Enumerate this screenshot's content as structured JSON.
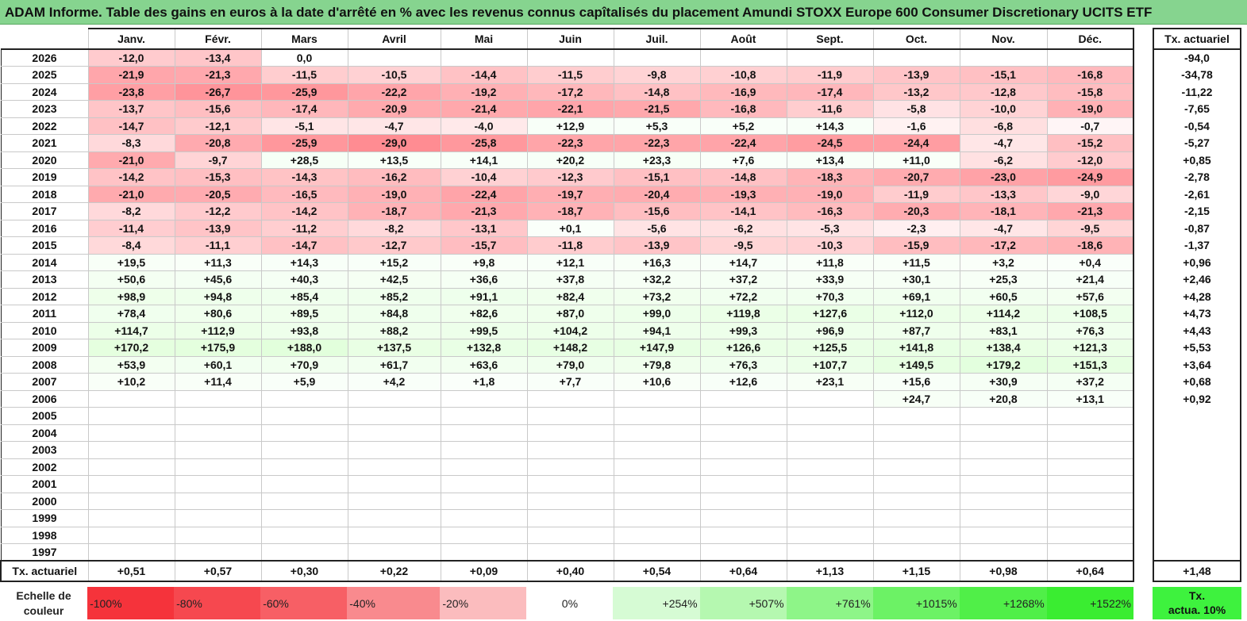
{
  "title": "ADAM Informe. Table des gains en euros à la date d'arrêté en % avec les revenus connus capîtalisés du placement Amundi STOXX Europe 600 Consumer Discretionary UCITS ETF",
  "months": [
    "Janv.",
    "Févr.",
    "Mars",
    "Avril",
    "Mai",
    "Juin",
    "Juil.",
    "Août",
    "Sept.",
    "Oct.",
    "Nov.",
    "Déc."
  ],
  "annual_header": "Tx. actuariel",
  "rows": [
    {
      "year": "2026",
      "values": [
        "-12,0",
        "-13,4",
        "0,0",
        "",
        "",
        "",
        "",
        "",
        "",
        "",
        "",
        ""
      ],
      "rate": "-94,0"
    },
    {
      "year": "2025",
      "values": [
        "-21,9",
        "-21,3",
        "-11,5",
        "-10,5",
        "-14,4",
        "-11,5",
        "-9,8",
        "-10,8",
        "-11,9",
        "-13,9",
        "-15,1",
        "-16,8"
      ],
      "rate": "-34,78"
    },
    {
      "year": "2024",
      "values": [
        "-23,8",
        "-26,7",
        "-25,9",
        "-22,2",
        "-19,2",
        "-17,2",
        "-14,8",
        "-16,9",
        "-17,4",
        "-13,2",
        "-12,8",
        "-15,8"
      ],
      "rate": "-11,22"
    },
    {
      "year": "2023",
      "values": [
        "-13,7",
        "-15,6",
        "-17,4",
        "-20,9",
        "-21,4",
        "-22,1",
        "-21,5",
        "-16,8",
        "-11,6",
        "-5,8",
        "-10,0",
        "-19,0"
      ],
      "rate": "-7,65"
    },
    {
      "year": "2022",
      "values": [
        "-14,7",
        "-12,1",
        "-5,1",
        "-4,7",
        "-4,0",
        "+12,9",
        "+5,3",
        "+5,2",
        "+14,3",
        "-1,6",
        "-6,8",
        "-0,7"
      ],
      "rate": "-0,54"
    },
    {
      "year": "2021",
      "values": [
        "-8,3",
        "-20,8",
        "-25,9",
        "-29,0",
        "-25,8",
        "-22,3",
        "-22,3",
        "-22,4",
        "-24,5",
        "-24,4",
        "-4,7",
        "-15,2"
      ],
      "rate": "-5,27"
    },
    {
      "year": "2020",
      "values": [
        "-21,0",
        "-9,7",
        "+28,5",
        "+13,5",
        "+14,1",
        "+20,2",
        "+23,3",
        "+7,6",
        "+13,4",
        "+11,0",
        "-6,2",
        "-12,0"
      ],
      "rate": "+0,85"
    },
    {
      "year": "2019",
      "values": [
        "-14,2",
        "-15,3",
        "-14,3",
        "-16,2",
        "-10,4",
        "-12,3",
        "-15,1",
        "-14,8",
        "-18,3",
        "-20,7",
        "-23,0",
        "-24,9"
      ],
      "rate": "-2,78"
    },
    {
      "year": "2018",
      "values": [
        "-21,0",
        "-20,5",
        "-16,5",
        "-19,0",
        "-22,4",
        "-19,7",
        "-20,4",
        "-19,3",
        "-19,0",
        "-11,9",
        "-13,3",
        "-9,0"
      ],
      "rate": "-2,61"
    },
    {
      "year": "2017",
      "values": [
        "-8,2",
        "-12,2",
        "-14,2",
        "-18,7",
        "-21,3",
        "-18,7",
        "-15,6",
        "-14,1",
        "-16,3",
        "-20,3",
        "-18,1",
        "-21,3"
      ],
      "rate": "-2,15"
    },
    {
      "year": "2016",
      "values": [
        "-11,4",
        "-13,9",
        "-11,2",
        "-8,2",
        "-13,1",
        "+0,1",
        "-5,6",
        "-6,2",
        "-5,3",
        "-2,3",
        "-4,7",
        "-9,5"
      ],
      "rate": "-0,87"
    },
    {
      "year": "2015",
      "values": [
        "-8,4",
        "-11,1",
        "-14,7",
        "-12,7",
        "-15,7",
        "-11,8",
        "-13,9",
        "-9,5",
        "-10,3",
        "-15,9",
        "-17,2",
        "-18,6"
      ],
      "rate": "-1,37"
    },
    {
      "year": "2014",
      "values": [
        "+19,5",
        "+11,3",
        "+14,3",
        "+15,2",
        "+9,8",
        "+12,1",
        "+16,3",
        "+14,7",
        "+11,8",
        "+11,5",
        "+3,2",
        "+0,4"
      ],
      "rate": "+0,96"
    },
    {
      "year": "2013",
      "values": [
        "+50,6",
        "+45,6",
        "+40,3",
        "+42,5",
        "+36,6",
        "+37,8",
        "+32,2",
        "+37,2",
        "+33,9",
        "+30,1",
        "+25,3",
        "+21,4"
      ],
      "rate": "+2,46"
    },
    {
      "year": "2012",
      "values": [
        "+98,9",
        "+94,8",
        "+85,4",
        "+85,2",
        "+91,1",
        "+82,4",
        "+73,2",
        "+72,2",
        "+70,3",
        "+69,1",
        "+60,5",
        "+57,6"
      ],
      "rate": "+4,28"
    },
    {
      "year": "2011",
      "values": [
        "+78,4",
        "+80,6",
        "+89,5",
        "+84,8",
        "+82,6",
        "+87,0",
        "+99,0",
        "+119,8",
        "+127,6",
        "+112,0",
        "+114,2",
        "+108,5"
      ],
      "rate": "+4,73"
    },
    {
      "year": "2010",
      "values": [
        "+114,7",
        "+112,9",
        "+93,8",
        "+88,2",
        "+99,5",
        "+104,2",
        "+94,1",
        "+99,3",
        "+96,9",
        "+87,7",
        "+83,1",
        "+76,3"
      ],
      "rate": "+4,43"
    },
    {
      "year": "2009",
      "values": [
        "+170,2",
        "+175,9",
        "+188,0",
        "+137,5",
        "+132,8",
        "+148,2",
        "+147,9",
        "+126,6",
        "+125,5",
        "+141,8",
        "+138,4",
        "+121,3"
      ],
      "rate": "+5,53"
    },
    {
      "year": "2008",
      "values": [
        "+53,9",
        "+60,1",
        "+70,9",
        "+61,7",
        "+63,6",
        "+79,0",
        "+79,8",
        "+76,3",
        "+107,7",
        "+149,5",
        "+179,2",
        "+151,3"
      ],
      "rate": "+3,64"
    },
    {
      "year": "2007",
      "values": [
        "+10,2",
        "+11,4",
        "+5,9",
        "+4,2",
        "+1,8",
        "+7,7",
        "+10,6",
        "+12,6",
        "+23,1",
        "+15,6",
        "+30,9",
        "+37,2"
      ],
      "rate": "+0,68"
    },
    {
      "year": "2006",
      "values": [
        "",
        "",
        "",
        "",
        "",
        "",
        "",
        "",
        "",
        "+24,7",
        "+20,8",
        "+13,1"
      ],
      "rate": "+0,92"
    },
    {
      "year": "2005",
      "values": [
        "",
        "",
        "",
        "",
        "",
        "",
        "",
        "",
        "",
        "",
        "",
        ""
      ],
      "rate": ""
    },
    {
      "year": "2004",
      "values": [
        "",
        "",
        "",
        "",
        "",
        "",
        "",
        "",
        "",
        "",
        "",
        ""
      ],
      "rate": ""
    },
    {
      "year": "2003",
      "values": [
        "",
        "",
        "",
        "",
        "",
        "",
        "",
        "",
        "",
        "",
        "",
        ""
      ],
      "rate": ""
    },
    {
      "year": "2002",
      "values": [
        "",
        "",
        "",
        "",
        "",
        "",
        "",
        "",
        "",
        "",
        "",
        ""
      ],
      "rate": ""
    },
    {
      "year": "2001",
      "values": [
        "",
        "",
        "",
        "",
        "",
        "",
        "",
        "",
        "",
        "",
        "",
        ""
      ],
      "rate": ""
    },
    {
      "year": "2000",
      "values": [
        "",
        "",
        "",
        "",
        "",
        "",
        "",
        "",
        "",
        "",
        "",
        ""
      ],
      "rate": ""
    },
    {
      "year": "1999",
      "values": [
        "",
        "",
        "",
        "",
        "",
        "",
        "",
        "",
        "",
        "",
        "",
        ""
      ],
      "rate": ""
    },
    {
      "year": "1998",
      "values": [
        "",
        "",
        "",
        "",
        "",
        "",
        "",
        "",
        "",
        "",
        "",
        ""
      ],
      "rate": ""
    },
    {
      "year": "1997",
      "values": [
        "",
        "",
        "",
        "",
        "",
        "",
        "",
        "",
        "",
        "",
        "",
        ""
      ],
      "rate": ""
    }
  ],
  "footer": {
    "label": "Tx. actuariel",
    "values": [
      "+0,51",
      "+0,57",
      "+0,30",
      "+0,22",
      "+0,09",
      "+0,40",
      "+0,54",
      "+0,64",
      "+1,13",
      "+1,15",
      "+0,98",
      "+0,64"
    ],
    "total": "+1,48"
  },
  "legend": {
    "label_line1": "Echelle de",
    "label_line2": "couleur",
    "items": [
      {
        "label": "-100%",
        "color": "#f5333b",
        "kind": "neg"
      },
      {
        "label": "-80%",
        "color": "#f6484f",
        "kind": "neg"
      },
      {
        "label": "-60%",
        "color": "#f75f65",
        "kind": "neg"
      },
      {
        "label": "-40%",
        "color": "#f98a8e",
        "kind": "neg"
      },
      {
        "label": "-20%",
        "color": "#fbbcbe",
        "kind": "neg"
      },
      {
        "label": "0%",
        "color": "#ffffff",
        "kind": "zero"
      },
      {
        "label": "+254%",
        "color": "#d6fbd4",
        "kind": "pos"
      },
      {
        "label": "+507%",
        "color": "#b5f8b0",
        "kind": "pos"
      },
      {
        "label": "+761%",
        "color": "#8ef588",
        "kind": "pos"
      },
      {
        "label": "+1015%",
        "color": "#6cf265",
        "kind": "pos"
      },
      {
        "label": "+1268%",
        "color": "#50ef48",
        "kind": "pos"
      },
      {
        "label": "+1522%",
        "color": "#3aed31",
        "kind": "pos"
      }
    ],
    "side_line1": "Tx.",
    "side_line2": "actua. 10%",
    "side_color": "#3ef23e"
  }
}
